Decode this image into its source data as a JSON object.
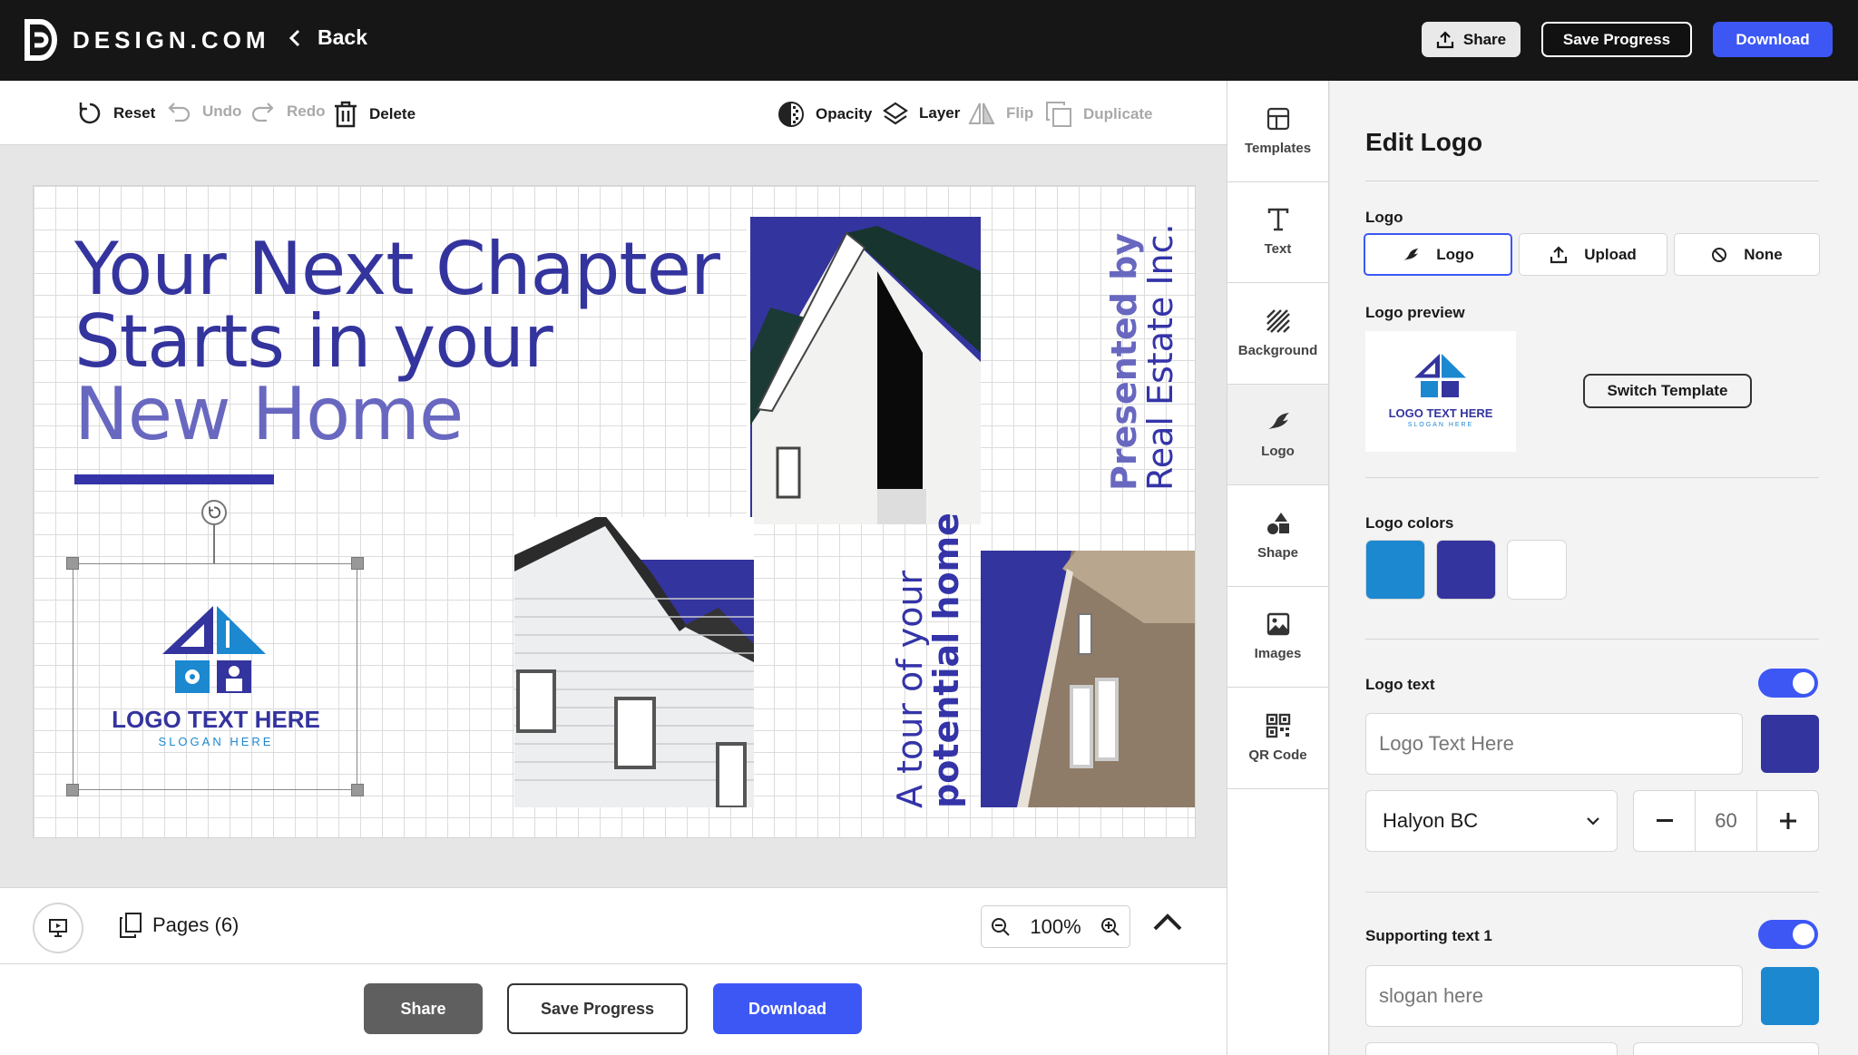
{
  "header": {
    "brand": "DESIGN.COM",
    "back_label": "Back",
    "share_label": "Share",
    "save_label": "Save Progress",
    "download_label": "Download"
  },
  "toolbar": {
    "reset": "Reset",
    "undo": "Undo",
    "redo": "Redo",
    "delete": "Delete",
    "opacity": "Opacity",
    "layer": "Layer",
    "flip": "Flip",
    "duplicate": "Duplicate"
  },
  "design": {
    "headline_line1": "Your Next Chapter",
    "headline_line2": "Starts in your",
    "headline_line3": "New Home",
    "tour_line1": "A tour of your",
    "tour_line2": "potential home",
    "presented_line1": "Presented by",
    "presented_line2": "Real Estate Inc.",
    "logo_text": "LOGO TEXT HERE",
    "slogan": "SLOGAN HERE"
  },
  "bottom": {
    "pages_label": "Pages (6)",
    "zoom": "100%",
    "share_label": "Share",
    "save_label": "Save Progress",
    "download_label": "Download"
  },
  "sidetabs": [
    {
      "label": "Templates",
      "icon": "layout-icon"
    },
    {
      "label": "Text",
      "icon": "text-icon"
    },
    {
      "label": "Background",
      "icon": "pattern-icon"
    },
    {
      "label": "Logo",
      "icon": "logo-icon"
    },
    {
      "label": "Shape",
      "icon": "shapes-icon"
    },
    {
      "label": "Images",
      "icon": "image-icon"
    },
    {
      "label": "QR Code",
      "icon": "qr-icon"
    }
  ],
  "panel": {
    "title": "Edit Logo",
    "logo_label": "Logo",
    "seg_logo": "Logo",
    "seg_upload": "Upload",
    "seg_none": "None",
    "preview_label": "Logo preview",
    "switch_template": "Switch Template",
    "colors_label": "Logo colors",
    "colors": [
      "#1b88d0",
      "#34349e",
      "#ffffff"
    ],
    "logo_text_label": "Logo text",
    "logo_text_value": "Logo Text Here",
    "logo_text_color": "#34349e",
    "font": "Halyon BC",
    "font_size": "60",
    "supporting_label": "Supporting text 1",
    "supporting_value": "slogan here",
    "supporting_color": "#1b88d0"
  }
}
